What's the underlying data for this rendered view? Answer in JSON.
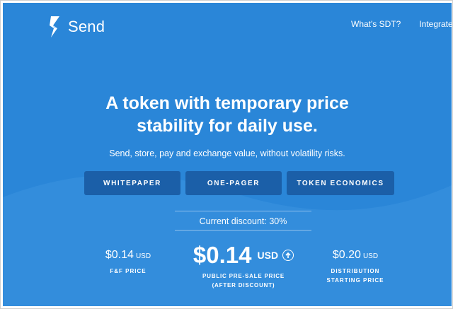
{
  "header": {
    "brand": "Send",
    "logo_icon": "send-s-logo-icon",
    "nav": [
      "What's SDT?",
      "Integrate"
    ]
  },
  "hero": {
    "headline": [
      "A token with temporary price",
      "stability for daily use."
    ],
    "subheadline": "Send, store, pay and exchange value, without volatility risks.",
    "buttons": [
      "WHITEPAPER",
      "ONE-PAGER",
      "TOKEN ECONOMICS"
    ]
  },
  "pricing": {
    "discount_text": "Current discount: 30%",
    "ff": {
      "amount": "$0.14",
      "currency": "USD",
      "label": "F&F PRICE"
    },
    "public": {
      "amount": "$0.14",
      "currency": "USD",
      "label_line1": "PUBLIC PRE-SALE PRICE",
      "label_line2": "(AFTER DISCOUNT)",
      "icon": "arrow-up-circle-icon"
    },
    "distribution": {
      "amount": "$0.20",
      "currency": "USD",
      "label_line1": "DISTRIBUTION",
      "label_line2": "STARTING PRICE"
    }
  },
  "colors": {
    "background": "#2a86d8",
    "button": "#1b5fa8",
    "wave": "#3a94e0",
    "text": "#ffffff"
  }
}
